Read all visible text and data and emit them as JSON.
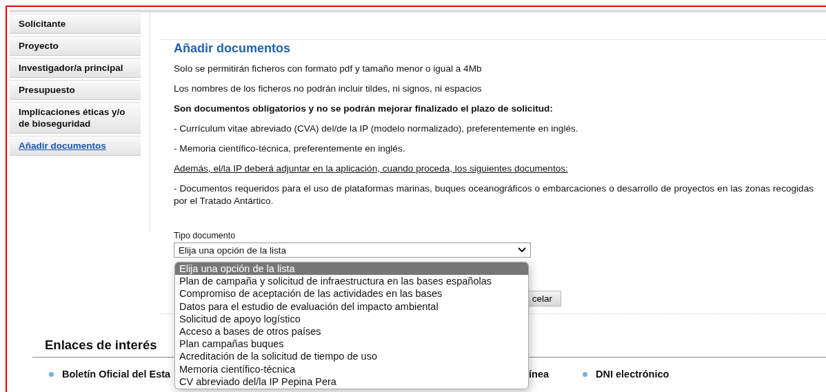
{
  "sidebar": {
    "items": [
      {
        "label": "Solicitante",
        "selected": false
      },
      {
        "label": "Proyecto",
        "selected": false
      },
      {
        "label": "Investigador/a principal",
        "selected": false
      },
      {
        "label": "Presupuesto",
        "selected": false
      },
      {
        "label": "Implicaciones éticas y/o de bioseguridad",
        "selected": false
      },
      {
        "label": "Añadir documentos",
        "selected": true
      }
    ]
  },
  "content": {
    "title": "Añadir documentos",
    "paragraphs": [
      {
        "kind": "plain",
        "text": "Solo se permitirán ficheros con formato pdf y tamaño menor o igual a 4Mb"
      },
      {
        "kind": "plain",
        "text": "Los nombres de los ficheros no podrán incluir tildes, ni signos, ni espacios"
      },
      {
        "kind": "bold",
        "text": "Son documentos obligatorios y no se podrán mejorar finalizado el plazo de solicitud:"
      },
      {
        "kind": "plain",
        "text": "- Currículum vitae abreviado (CVA) del/de la IP (modelo normalizado), preferentemente en inglés."
      },
      {
        "kind": "plain",
        "text": "- Memoria científico-técnica, preferentemente en inglés."
      },
      {
        "kind": "underline",
        "text": "Además, el/la IP deberá adjuntar en la aplicación, cuando proceda, los siguientes documentos:"
      },
      {
        "kind": "justify",
        "text": "- Documentos requeridos para el uso de plataformas marinas, buques oceanográficos o embarcaciones o desarrollo de proyectos en las zonas recogidas por el Tratado Antártico."
      }
    ],
    "document_type": {
      "label": "Tipo documento",
      "value": "Elija una opción de la lista",
      "options": [
        {
          "label": "Elija una opción de la lista",
          "selected": true
        },
        {
          "label": "Plan de campaña y solicitud de infraestructura en las bases españolas",
          "selected": false
        },
        {
          "label": "Compromiso de aceptación de las actividades en las bases",
          "selected": false
        },
        {
          "label": "Datos para el estudio de evaluación del impacto ambiental",
          "selected": false
        },
        {
          "label": "Solicitud de apoyo logístico",
          "selected": false
        },
        {
          "label": "Acceso a bases de otros países",
          "selected": false
        },
        {
          "label": "Plan campañas buques",
          "selected": false
        },
        {
          "label": "Acreditación de la solicitud de tiempo de uso",
          "selected": false
        },
        {
          "label": "Memoria científico-técnica",
          "selected": false
        },
        {
          "label": "CV abreviado del/la IP Pepina Pera",
          "selected": false
        }
      ]
    },
    "cancel_button": "celar"
  },
  "links": {
    "title": "Enlaces de interés",
    "items": [
      {
        "kind": "bullet",
        "label": "Boletín Oficial del Esta"
      },
      {
        "kind": "plain",
        "label": "ínea"
      },
      {
        "kind": "bullet",
        "label": "DNI electrónico"
      }
    ]
  }
}
